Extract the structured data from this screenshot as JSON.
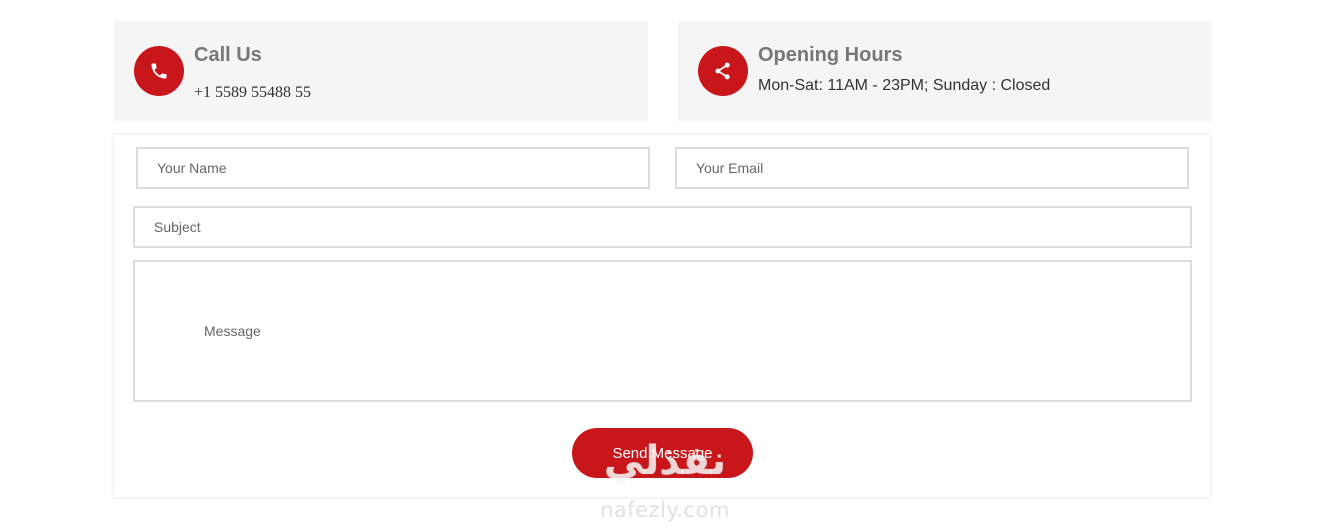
{
  "contact_info": {
    "call": {
      "icon": "phone-icon",
      "title": "Call Us",
      "text": "+1 5589 55488 55"
    },
    "hours": {
      "icon": "share-icon",
      "title": "Opening Hours",
      "text": "Mon-Sat: 11AM - 23PM; Sunday : Closed"
    }
  },
  "form": {
    "name_placeholder": "Your Name",
    "email_placeholder": "Your Email",
    "subject_placeholder": "Subject",
    "message_placeholder": "Message",
    "submit_label": "Send Message"
  },
  "watermark": {
    "arabic": "نفذلي",
    "latin": "nafezly.com"
  },
  "colors": {
    "accent": "#c8161b",
    "box_background": "#f5f5f5",
    "title_gray": "#777777",
    "border": "#dcdcdc"
  }
}
